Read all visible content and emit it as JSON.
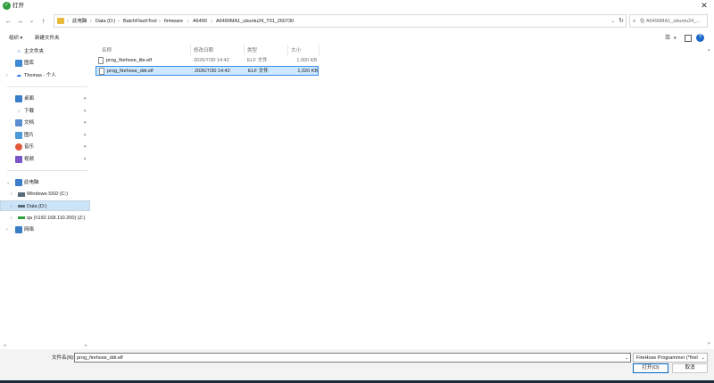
{
  "window": {
    "title": "打开",
    "close_glyph": "✕"
  },
  "nav": {
    "back": "←",
    "forward": "→",
    "recent": "⌄",
    "up": "↑"
  },
  "address": {
    "crumbs": [
      "此电脑",
      "Data (D:)",
      "BatchFlashTool",
      "firmware",
      "A6490",
      "A6490MA1_ubuntu24_T01_260730"
    ],
    "separator": "›",
    "refresh": "↻"
  },
  "search": {
    "placeholder": "在 A6490MA1_ubuntu24_..."
  },
  "toolbar": {
    "organize": "组织 ▾",
    "new_folder": "新建文件夹"
  },
  "sidebar": {
    "items": [
      {
        "label": "主文件夹",
        "icon": "home-icon"
      },
      {
        "label": "图库",
        "icon": "gallery-icon"
      },
      {
        "label": "Thomas - 个人",
        "icon": "cloud-icon"
      },
      {
        "label": "桌面",
        "icon": "desktop-icon"
      },
      {
        "label": "下载",
        "icon": "download-icon"
      },
      {
        "label": "文档",
        "icon": "document-icon"
      },
      {
        "label": "图片",
        "icon": "pictures-icon"
      },
      {
        "label": "音乐",
        "icon": "music-icon"
      },
      {
        "label": "视频",
        "icon": "video-icon"
      },
      {
        "label": "此电脑",
        "icon": "computer-icon"
      },
      {
        "label": "Windows-SSD (C:)",
        "icon": "drive-icon"
      },
      {
        "label": "Data (D:)",
        "icon": "drive-icon"
      },
      {
        "label": "qa (\\\\192.168.110.200) (Z:)",
        "icon": "network-drive-icon"
      },
      {
        "label": "网络",
        "icon": "network-icon"
      }
    ],
    "pin_glyph": "📌"
  },
  "columns": {
    "name": "名称",
    "modified": "修改日期",
    "type": "类型",
    "size": "大小"
  },
  "files": [
    {
      "name": "prog_firehose_lite.elf",
      "modified": "2026/7/30 14:42",
      "type": "ELF 文件",
      "size": "1,000 KB"
    },
    {
      "name": "prog_firehose_ddr.elf",
      "modified": "2026/7/30 14:42",
      "type": "ELF 文件",
      "size": "1,020 KB"
    }
  ],
  "footer": {
    "filename_label": "文件名(N):",
    "filename_value": "prog_firehose_ddr.elf",
    "filter": "FireHose Programmer (*firel",
    "open": "打开(O)",
    "cancel": "取消"
  },
  "colors": {
    "selection": "#cce8ff",
    "selection_border": "#3b8ee8",
    "accent": "#0067c0"
  }
}
